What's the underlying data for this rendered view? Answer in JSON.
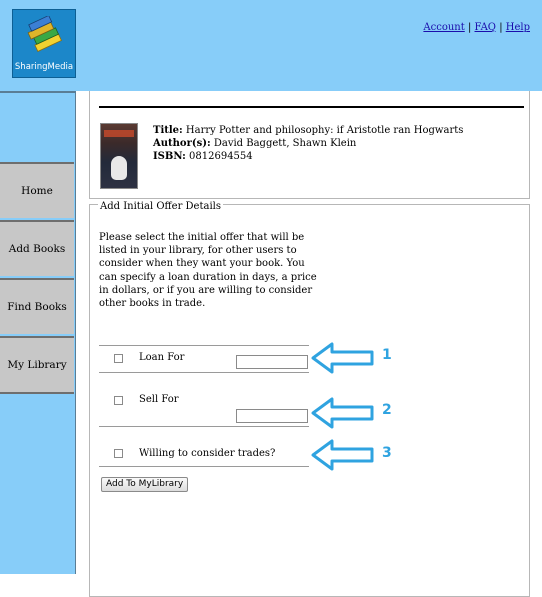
{
  "logo": {
    "text": "SharingMedia",
    "icon": "book-stack-icon"
  },
  "toplinks": {
    "account": "Account",
    "faq": "FAQ",
    "help": "Help",
    "sep": "|"
  },
  "sidebar": {
    "items": [
      {
        "label": "Home"
      },
      {
        "label": "Add Books"
      },
      {
        "label": "Find Books"
      },
      {
        "label": "My Library"
      }
    ]
  },
  "book": {
    "title_label": "Title:",
    "title": "Harry Potter and philosophy: if Aristotle ran Hogwarts",
    "authors_label": "Author(s):",
    "authors": "David Baggett, Shawn Klein",
    "isbn_label": "ISBN:",
    "isbn": "0812694554"
  },
  "offer": {
    "legend": "Add Initial Offer Details",
    "description": "Please select the initial offer that will be listed in your library, for other users to consider when they want your book. You can specify a loan duration in days, a price in dollars, or if you are willing to consider other books in trade.",
    "loan_label": "Loan For",
    "loan_value": "",
    "sell_label": "Sell For",
    "sell_value": "",
    "trade_label": "Willing to consider trades?",
    "submit_label": "Add To MyLibrary"
  },
  "annotations": {
    "one": "1",
    "two": "2",
    "three": "3",
    "arrow_color": "#2fa3e0"
  },
  "colors": {
    "header_bg": "#87cdf9",
    "nav_bg": "#c7c7c7",
    "logo_bg": "#1c87c9"
  }
}
